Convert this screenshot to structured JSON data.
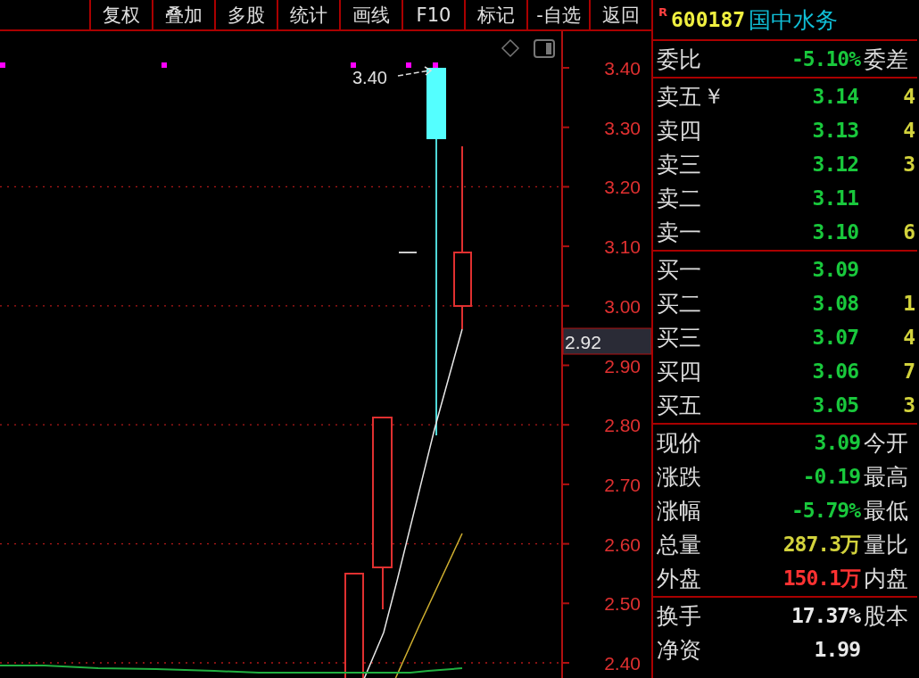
{
  "toolbar": {
    "buttons": [
      "复权",
      "叠加",
      "多股",
      "统计",
      "画线",
      "F10",
      "标记",
      "-自选",
      "返回"
    ]
  },
  "chart": {
    "high_label": "3.40",
    "y_axis_labels": [
      "3.40",
      "3.30",
      "3.20",
      "3.10",
      "3.00",
      "2.90",
      "2.80",
      "2.70",
      "2.60",
      "2.50",
      "2.40"
    ],
    "current_price": "2.92"
  },
  "quote": {
    "flag": "R",
    "code": "600187",
    "name": "国中水务"
  },
  "ratio_row": {
    "label": "委比",
    "value": "-5.10%",
    "label_2": "委差"
  },
  "sell_rows": [
    {
      "label": "卖五",
      "mark": "￥",
      "price": "3.14",
      "volume": "4"
    },
    {
      "label": "卖四",
      "price": "3.13",
      "volume": "4"
    },
    {
      "label": "卖三",
      "price": "3.12",
      "volume": "3"
    },
    {
      "label": "卖二",
      "price": "3.11"
    },
    {
      "label": "卖一",
      "price": "3.10",
      "volume": "6"
    }
  ],
  "buy_rows": [
    {
      "label": "买一",
      "price": "3.09"
    },
    {
      "label": "买二",
      "price": "3.08",
      "volume": "1"
    },
    {
      "label": "买三",
      "price": "3.07",
      "volume": "4"
    },
    {
      "label": "买四",
      "price": "3.06",
      "volume": "7"
    },
    {
      "label": "买五",
      "price": "3.05",
      "volume": "3"
    }
  ],
  "stats": [
    {
      "label": "现价",
      "value": "3.09",
      "color": "#19c83c",
      "label_2": "今开"
    },
    {
      "label": "涨跌",
      "value": "-0.19",
      "color": "#19c83c",
      "label_2": "最高"
    },
    {
      "label": "涨幅",
      "value": "-5.79%",
      "color": "#19c83c",
      "label_2": "最低"
    },
    {
      "label": "总量",
      "value": "287.3万",
      "color": "#d2d23c",
      "label_2": "量比"
    },
    {
      "label": "外盘",
      "value": "150.1万",
      "color": "#ff3232",
      "label_2": "内盘"
    }
  ],
  "fundamentals": [
    {
      "label": "换手",
      "value": "17.37%",
      "label_2": "股本"
    },
    {
      "label": "净资",
      "value": "1.99"
    }
  ]
}
